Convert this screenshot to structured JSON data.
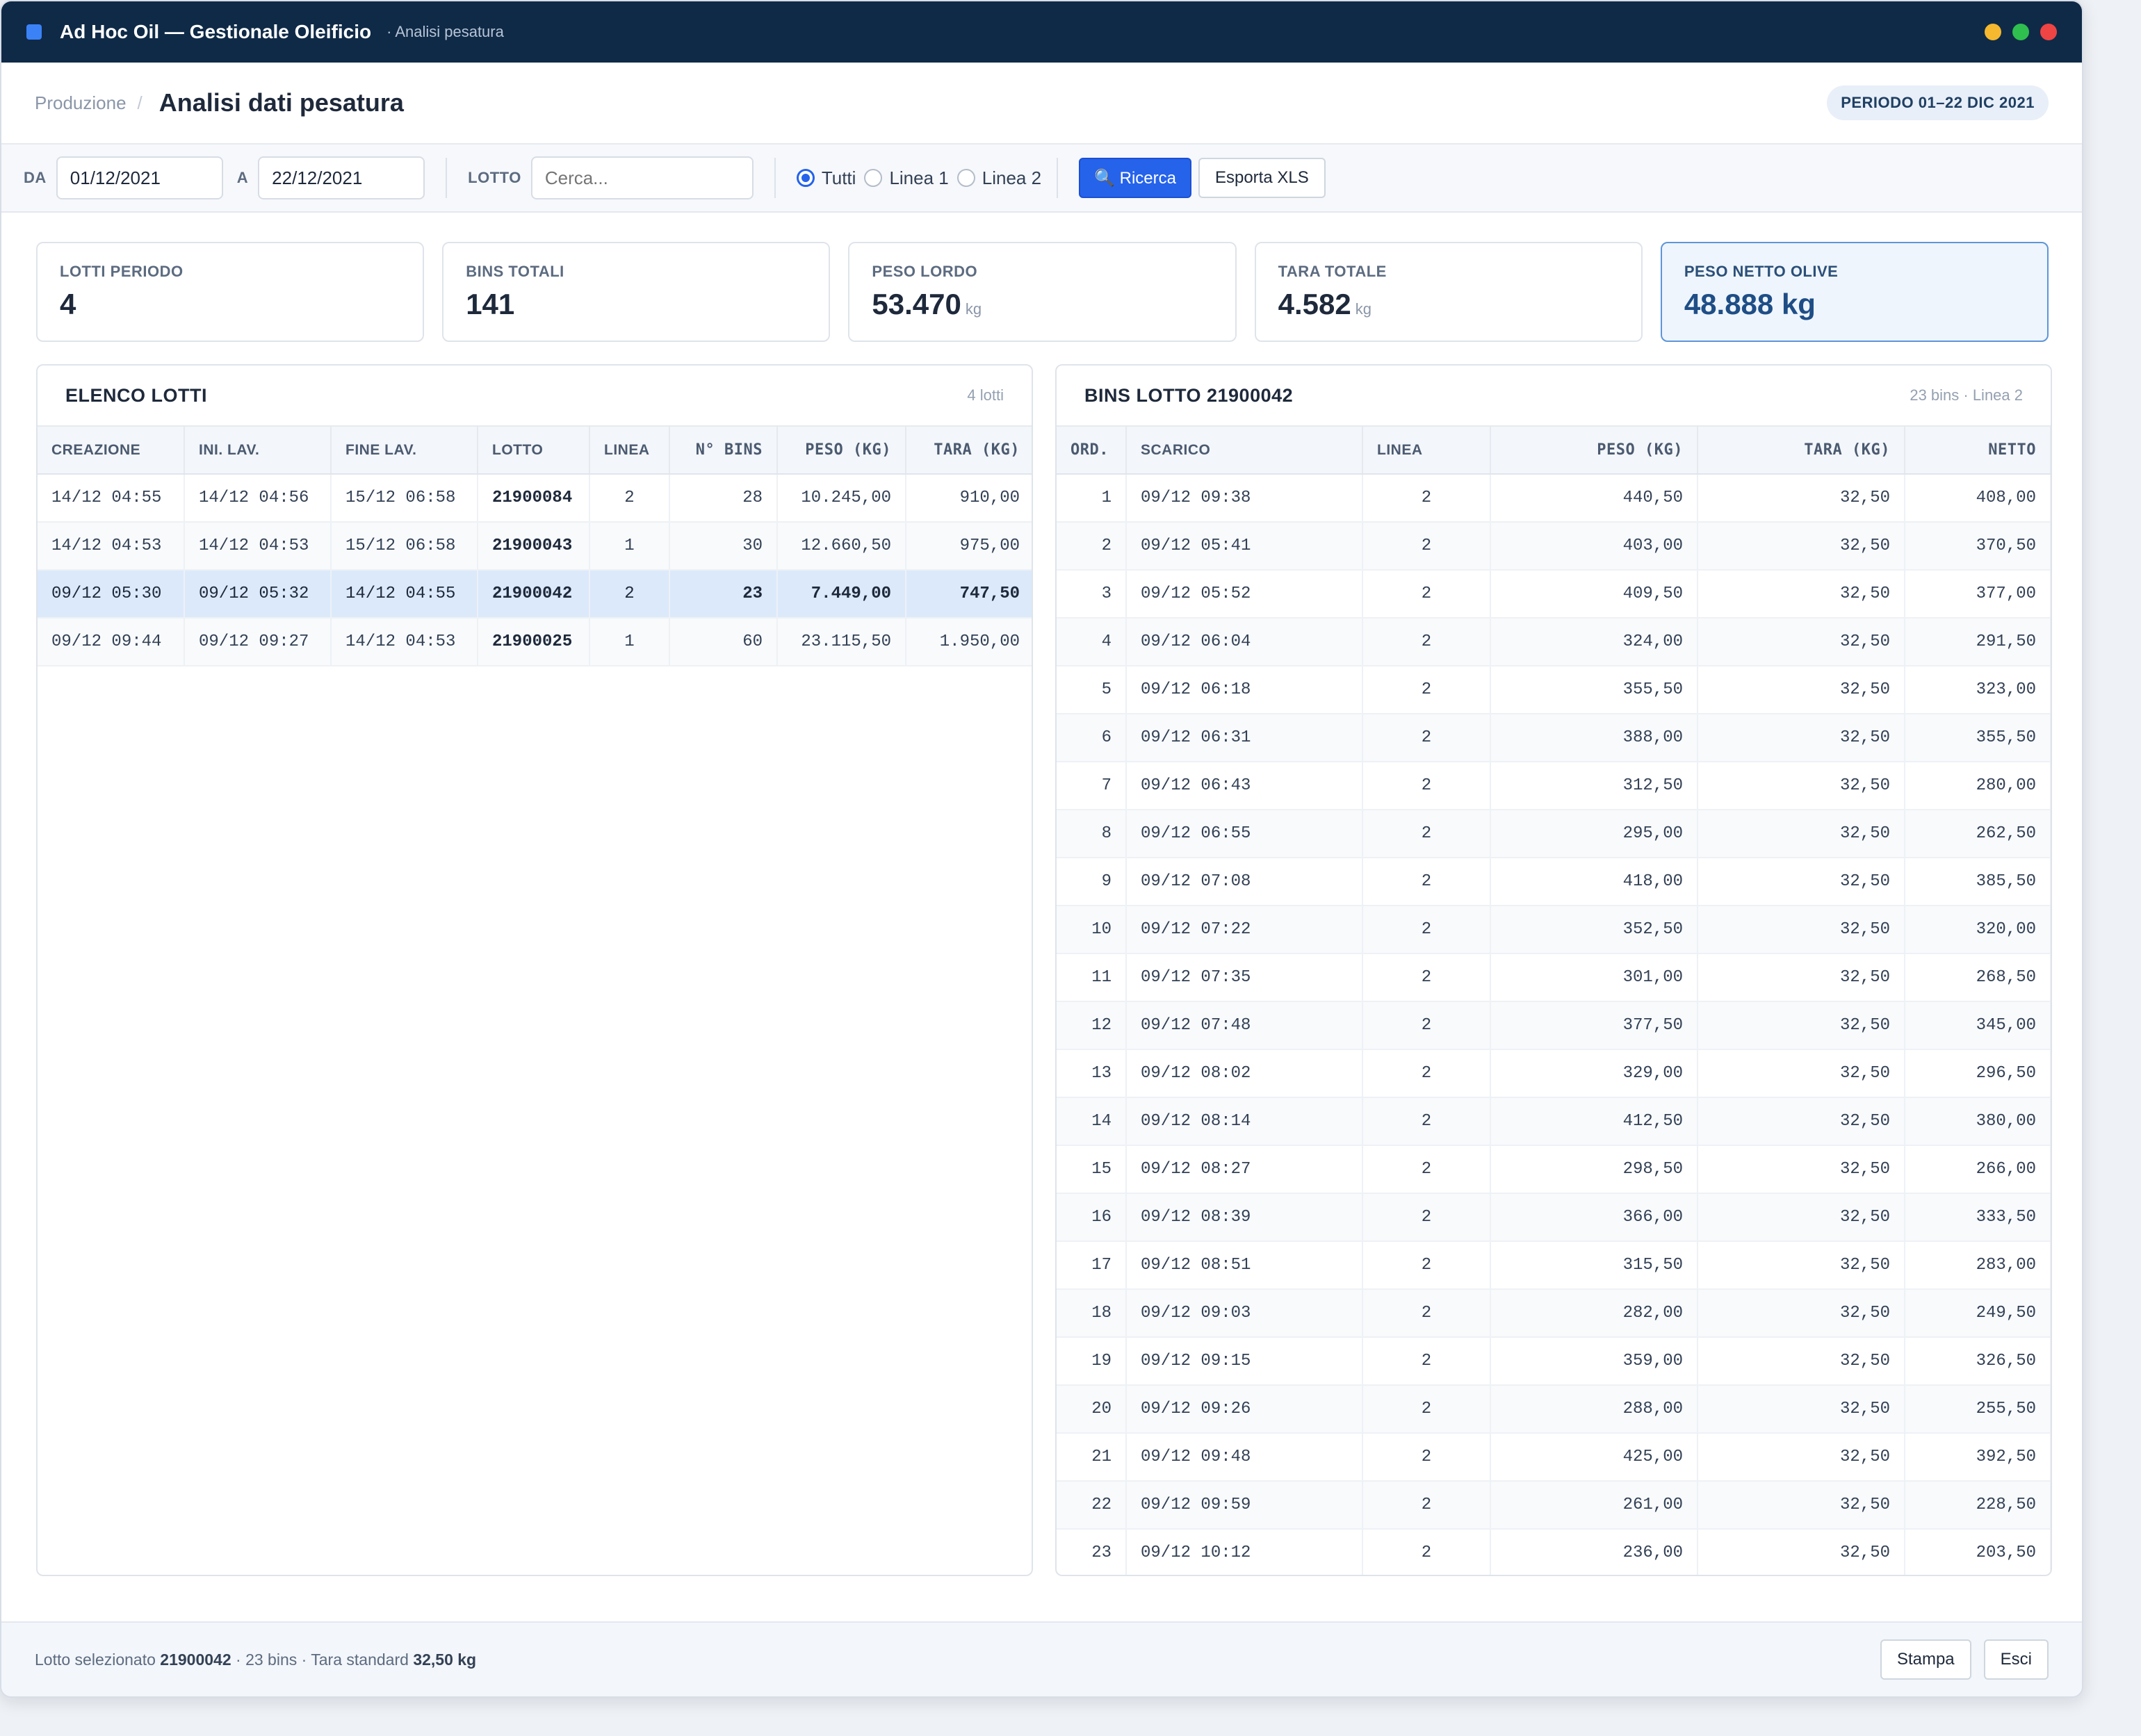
{
  "window": {
    "app_title": "Ad Hoc Oil — Gestionale Oleificio",
    "app_subtitle": "· Analisi pesatura",
    "controls": {
      "minimize_color": "#f5b82e",
      "maximize_color": "#2fbf4f",
      "close_color": "#ef4444"
    }
  },
  "header": {
    "breadcrumb": "Produzione",
    "breadcrumb_sep": "/",
    "title": "Analisi dati pesatura",
    "period_badge": "PERIODO 01–22 DIC 2021"
  },
  "filters": {
    "from_label": "DA",
    "from_value": "01/12/2021",
    "to_label": "A",
    "to_value": "22/12/2021",
    "lotto_label": "LOTTO",
    "lotto_placeholder": "Cerca...",
    "radio_all": "Tutti",
    "radio_line1": "Linea 1",
    "radio_line2": "Linea 2",
    "selected_radio": "Tutti",
    "search_button": "🔍 Ricerca",
    "export_button": "Esporta XLS"
  },
  "stats": [
    {
      "label": "LOTTI PERIODO",
      "value": "4",
      "unit": ""
    },
    {
      "label": "BINS TOTALI",
      "value": "141",
      "unit": ""
    },
    {
      "label": "PESO LORDO",
      "value": "53.470",
      "unit": "kg"
    },
    {
      "label": "TARA TOTALE",
      "value": "4.582",
      "unit": "kg"
    },
    {
      "label": "PESO NETTO OLIVE",
      "value": "48.888 kg",
      "unit": ""
    }
  ],
  "lots_panel": {
    "title": "ELENCO LOTTI",
    "meta": "4 lotti",
    "columns": [
      "CREAZIONE",
      "INI. LAV.",
      "FINE LAV.",
      "LOTTO",
      "LINEA",
      "N° BINS",
      "PESO (KG)",
      "TARA (KG)"
    ],
    "rows": [
      [
        "14/12 04:55",
        "14/12 04:56",
        "15/12 06:58",
        "21900084",
        "2",
        "28",
        "10.245,00",
        "910,00"
      ],
      [
        "14/12 04:53",
        "14/12 04:53",
        "15/12 06:58",
        "21900043",
        "1",
        "30",
        "12.660,50",
        "975,00"
      ],
      [
        "09/12 05:30",
        "09/12 05:32",
        "14/12 04:55",
        "21900042",
        "2",
        "23",
        "7.449,00",
        "747,50"
      ],
      [
        "09/12 09:44",
        "09/12 09:27",
        "14/12 04:53",
        "21900025",
        "1",
        "60",
        "23.115,50",
        "1.950,00"
      ]
    ],
    "selected_row": 2
  },
  "bins_panel": {
    "title": "BINS LOTTO 21900042",
    "meta": "23 bins · Linea 2",
    "columns": [
      "ORD.",
      "SCARICO",
      "LINEA",
      "PESO (KG)",
      "TARA (KG)",
      "NETTO"
    ],
    "rows": [
      [
        "1",
        "09/12 09:38",
        "2",
        "440,50",
        "32,50",
        "408,00"
      ],
      [
        "2",
        "09/12 05:41",
        "2",
        "403,00",
        "32,50",
        "370,50"
      ],
      [
        "3",
        "09/12 05:52",
        "2",
        "409,50",
        "32,50",
        "377,00"
      ],
      [
        "4",
        "09/12 06:04",
        "2",
        "324,00",
        "32,50",
        "291,50"
      ],
      [
        "5",
        "09/12 06:18",
        "2",
        "355,50",
        "32,50",
        "323,00"
      ],
      [
        "6",
        "09/12 06:31",
        "2",
        "388,00",
        "32,50",
        "355,50"
      ],
      [
        "7",
        "09/12 06:43",
        "2",
        "312,50",
        "32,50",
        "280,00"
      ],
      [
        "8",
        "09/12 06:55",
        "2",
        "295,00",
        "32,50",
        "262,50"
      ],
      [
        "9",
        "09/12 07:08",
        "2",
        "418,00",
        "32,50",
        "385,50"
      ],
      [
        "10",
        "09/12 07:22",
        "2",
        "352,50",
        "32,50",
        "320,00"
      ],
      [
        "11",
        "09/12 07:35",
        "2",
        "301,00",
        "32,50",
        "268,50"
      ],
      [
        "12",
        "09/12 07:48",
        "2",
        "377,50",
        "32,50",
        "345,00"
      ],
      [
        "13",
        "09/12 08:02",
        "2",
        "329,00",
        "32,50",
        "296,50"
      ],
      [
        "14",
        "09/12 08:14",
        "2",
        "412,50",
        "32,50",
        "380,00"
      ],
      [
        "15",
        "09/12 08:27",
        "2",
        "298,50",
        "32,50",
        "266,00"
      ],
      [
        "16",
        "09/12 08:39",
        "2",
        "366,00",
        "32,50",
        "333,50"
      ],
      [
        "17",
        "09/12 08:51",
        "2",
        "315,50",
        "32,50",
        "283,00"
      ],
      [
        "18",
        "09/12 09:03",
        "2",
        "282,00",
        "32,50",
        "249,50"
      ],
      [
        "19",
        "09/12 09:15",
        "2",
        "359,00",
        "32,50",
        "326,50"
      ],
      [
        "20",
        "09/12 09:26",
        "2",
        "288,00",
        "32,50",
        "255,50"
      ],
      [
        "21",
        "09/12 09:48",
        "2",
        "425,00",
        "32,50",
        "392,50"
      ],
      [
        "22",
        "09/12 09:59",
        "2",
        "261,00",
        "32,50",
        "228,50"
      ],
      [
        "23",
        "09/12 10:12",
        "2",
        "236,00",
        "32,50",
        "203,50"
      ]
    ]
  },
  "footer": {
    "prefix": "Lotto selezionato",
    "lot": "21900042",
    "middle": "· 23 bins · Tara standard",
    "tare": "32,50 kg",
    "print_button": "Stampa",
    "exit_button": "Esci"
  }
}
